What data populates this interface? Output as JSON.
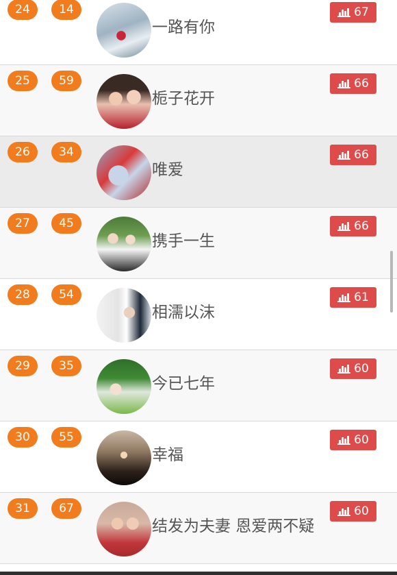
{
  "colors": {
    "rank_pill": "#f07c1e",
    "votes_badge": "#dd4b4b",
    "row_alt": "#f8f8f8",
    "row_highlight": "#ebebeb"
  },
  "vote_icon": "bar-chart-icon",
  "rows": [
    {
      "rank": "24",
      "number": "14",
      "name": "一路有你",
      "votes": "67",
      "photo": "couple-photo-boat"
    },
    {
      "rank": "25",
      "number": "59",
      "name": "栀子花开",
      "votes": "66",
      "photo": "couple-photo-selfie"
    },
    {
      "rank": "26",
      "number": "34",
      "name": "唯爱",
      "votes": "66",
      "photo": "couple-photo-red"
    },
    {
      "rank": "27",
      "number": "45",
      "name": "携手一生",
      "votes": "66",
      "photo": "couple-photo-garden"
    },
    {
      "rank": "28",
      "number": "54",
      "name": "相濡以沫",
      "votes": "61",
      "photo": "couple-photo-window"
    },
    {
      "rank": "29",
      "number": "35",
      "name": "今已七年",
      "votes": "60",
      "photo": "couple-photo-lawn"
    },
    {
      "rank": "30",
      "number": "55",
      "name": "幸福",
      "votes": "60",
      "photo": "couple-photo-proposal"
    },
    {
      "rank": "31",
      "number": "67",
      "name": "结发为夫妻 恩爱两不疑",
      "votes": "60",
      "photo": "couple-photo-studio"
    }
  ]
}
